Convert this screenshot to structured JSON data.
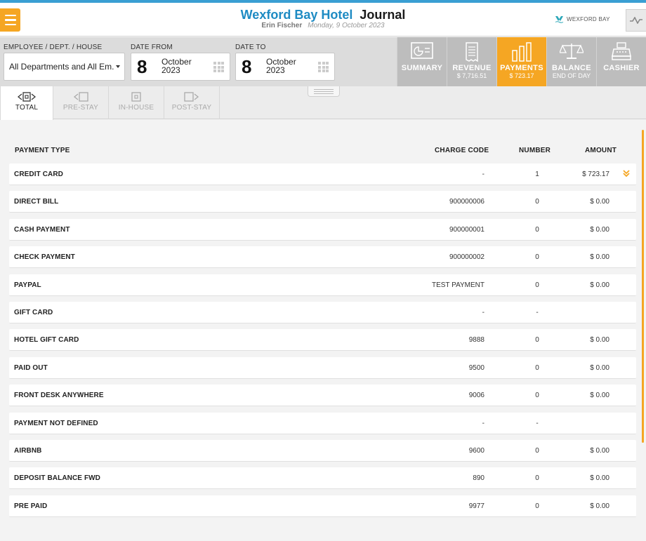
{
  "header": {
    "hotel_name": "Wexford Bay Hotel",
    "page_title": "Journal",
    "user_name": "Erin Fischer",
    "date_text": "Monday, 9 October 2023",
    "brand_label": "WEXFORD BAY"
  },
  "filters": {
    "employee_label": "EMPLOYEE / DEPT. / HOUSE",
    "employee_value": "All Departments and All Em.",
    "date_from_label": "DATE FROM",
    "date_from_day": "8",
    "date_from_month": "October",
    "date_from_year": "2023",
    "date_to_label": "DATE TO",
    "date_to_day": "8",
    "date_to_month": "October",
    "date_to_year": "2023"
  },
  "nav": {
    "summary": {
      "label": "SUMMARY",
      "sub": ""
    },
    "revenue": {
      "label": "REVENUE",
      "sub": "$ 7,716.51"
    },
    "payments": {
      "label": "PAYMENTS",
      "sub": "$ 723.17"
    },
    "balance": {
      "label": "BALANCE",
      "sub": "END OF DAY"
    },
    "cashier": {
      "label": "CASHIER",
      "sub": ""
    },
    "active": "payments"
  },
  "subtabs": {
    "total": "TOTAL",
    "pre_stay": "PRE-STAY",
    "in_house": "IN-HOUSE",
    "post_stay": "POST-STAY",
    "active": "total"
  },
  "table": {
    "headers": {
      "payment_type": "PAYMENT TYPE",
      "charge_code": "CHARGE CODE",
      "number": "NUMBER",
      "amount": "AMOUNT"
    },
    "rows": [
      {
        "type": "CREDIT CARD",
        "code": "-",
        "number": "1",
        "amount": "$ 723.17",
        "expandable": true
      },
      {
        "type": "DIRECT BILL",
        "code": "900000006",
        "number": "0",
        "amount": "$ 0.00"
      },
      {
        "type": "CASH PAYMENT",
        "code": "900000001",
        "number": "0",
        "amount": "$ 0.00"
      },
      {
        "type": "CHECK PAYMENT",
        "code": "900000002",
        "number": "0",
        "amount": "$ 0.00"
      },
      {
        "type": "PAYPAL",
        "code": "TEST PAYMENT",
        "number": "0",
        "amount": "$ 0.00"
      },
      {
        "type": "GIFT CARD",
        "code": "-",
        "number": "-",
        "amount": ""
      },
      {
        "type": "HOTEL GIFT CARD",
        "code": "9888",
        "number": "0",
        "amount": "$ 0.00"
      },
      {
        "type": "PAID OUT",
        "code": "9500",
        "number": "0",
        "amount": "$ 0.00"
      },
      {
        "type": "FRONT DESK ANYWHERE",
        "code": "9006",
        "number": "0",
        "amount": "$ 0.00"
      },
      {
        "type": "PAYMENT NOT DEFINED",
        "code": "-",
        "number": "-",
        "amount": ""
      },
      {
        "type": "AIRBNB",
        "code": "9600",
        "number": "0",
        "amount": "$ 0.00"
      },
      {
        "type": "DEPOSIT BALANCE FWD",
        "code": "890",
        "number": "0",
        "amount": "$ 0.00"
      },
      {
        "type": "PRE PAID",
        "code": "9977",
        "number": "0",
        "amount": "$ 0.00"
      }
    ]
  },
  "colors": {
    "accent": "#f5a623",
    "brand_blue": "#1e8bc3",
    "tab_inactive": "#bdbdbd"
  },
  "icons": [
    "menu-icon",
    "wexford-bay-logo-icon",
    "activity-icon",
    "summary-icon",
    "revenue-icon",
    "payments-icon",
    "balance-icon",
    "cashier-icon",
    "calendar-grid-icon",
    "expand-chevron-icon"
  ]
}
